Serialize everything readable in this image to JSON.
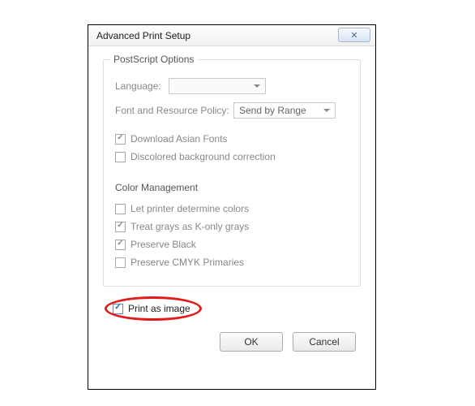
{
  "window": {
    "title": "Advanced Print Setup",
    "close_glyph": "✕"
  },
  "postscript": {
    "group_title": "PostScript Options",
    "language_label": "Language:",
    "language_value": "",
    "policy_label": "Font and Resource Policy:",
    "policy_value": "Send by Range",
    "download_asian_label": "Download Asian Fonts",
    "discolored_label": "Discolored background correction"
  },
  "color": {
    "subhead": "Color Management",
    "let_printer_label": "Let printer determine colors",
    "treat_grays_label": "Treat grays as K-only grays",
    "preserve_black_label": "Preserve Black",
    "preserve_cmyk_label": "Preserve CMYK Primaries"
  },
  "print_as_image_label": "Print as image",
  "buttons": {
    "ok": "OK",
    "cancel": "Cancel"
  }
}
